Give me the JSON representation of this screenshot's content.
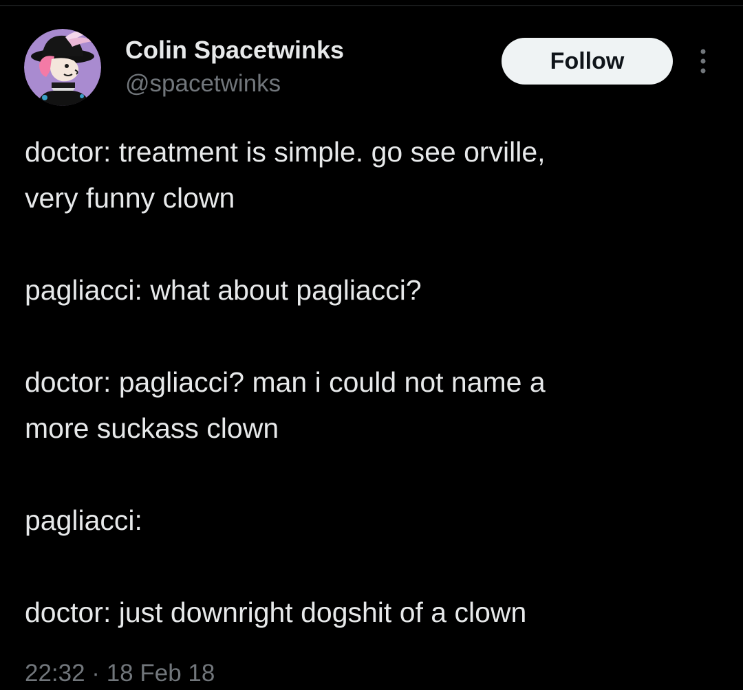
{
  "author": {
    "name": "Colin Spacetwinks",
    "handle": "@spacetwinks",
    "avatar_icon": "avatar-illustration-icon"
  },
  "actions": {
    "follow_label": "Follow",
    "more_icon": "more-vertical-icon"
  },
  "tweet": {
    "lines": [
      "doctor: treatment is simple. go see orville,",
      "very funny clown",
      "",
      "pagliacci: what about pagliacci?",
      "",
      "doctor: pagliacci? man i could not name a",
      "more suckass clown",
      "",
      "pagliacci:",
      "",
      "doctor: just downright dogshit of a clown"
    ]
  },
  "meta": {
    "timestamp": "22:32 · 18 Feb 18"
  },
  "colors": {
    "background": "#000000",
    "text_primary": "#e7e9ea",
    "text_secondary": "#71767b",
    "follow_bg": "#eff3f4",
    "avatar_bg": "#a98bd0"
  }
}
